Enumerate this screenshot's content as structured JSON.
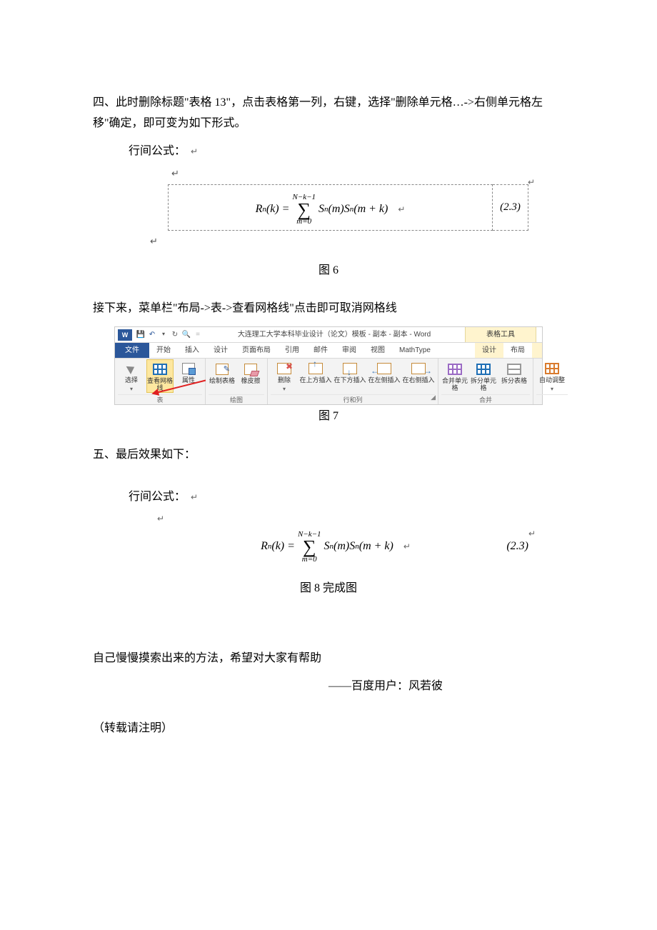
{
  "step4_text": "四、此时删除标题\"表格 13\"，点击表格第一列，右键，选择\"删除单元格…->右侧单元格左移\"确定，即可变为如下形式。",
  "fig6_caption": "图 6",
  "eq_prefix": "行间公式：",
  "return_mark": "↵",
  "return_mark2": "↵",
  "eq_left_1": "R",
  "eq_left_sub": "n",
  "eq_left_2": "(k) = ",
  "eq_sum_top": "N−k−1",
  "eq_sum_symbol": "∑",
  "eq_sum_bot": "m=0",
  "eq_right_1": " S",
  "eq_right_sub1": "n",
  "eq_right_2": "(m)S",
  "eq_right_sub2": "n",
  "eq_right_3": "(m + k)",
  "eq_number": "(2.3)",
  "between_text": "接下来，菜单栏\"布局->表->查看网格线\"点击即可取消网格线",
  "ribbon": {
    "word_icon": "W",
    "save_icon": "💾",
    "undo_icon": "↶",
    "redo_icon": "↻",
    "dropdown_icon": "▾",
    "search_icon": "🔍",
    "eq_sep": "=",
    "title": "大连理工大学本科毕业设计（论文）模板 - 副本 - 副本 - Word",
    "tools_title": "表格工具",
    "tabs": {
      "file": "文件",
      "home": "开始",
      "insert": "插入",
      "design": "设计",
      "layout": "页面布局",
      "references": "引用",
      "mailings": "邮件",
      "review": "审阅",
      "view": "视图",
      "mathtype": "MathType",
      "tdesign": "设计",
      "tlayout": "布局"
    },
    "buttons": {
      "select": "选择",
      "gridlines": "查看网格线",
      "properties": "属性",
      "draw": "绘制表格",
      "eraser": "橡皮擦",
      "delete": "删除",
      "ins_above": "在上方插入",
      "ins_below": "在下方插入",
      "ins_left": "在左侧插入",
      "ins_right": "在右侧插入",
      "merge": "合并单元格",
      "split": "拆分单元格",
      "split_table": "拆分表格",
      "autofit": "自动调整"
    },
    "groups": {
      "table": "表",
      "draw": "绘图",
      "rowcol": "行和列",
      "merge": "合并"
    }
  },
  "fig7_caption": "图 7",
  "step5_text": "五、最后效果如下：",
  "fig8_caption": "图 8 完成图",
  "closing_line": "自己慢慢摸索出来的方法，希望对大家有帮助",
  "signature": "——百度用户：风若彼",
  "repost_note": "（转载请注明）"
}
